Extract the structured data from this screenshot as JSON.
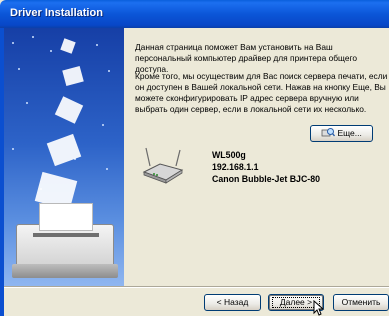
{
  "window": {
    "title": "Driver Installation"
  },
  "intro": {
    "paragraph1": "Данная страница поможет Вам установить на Ваш персональный компьютер драйвер для принтера общего доступа.",
    "paragraph2": "Кроме того, мы осуществим для Вас поиск сервера печати, если он доступен в Вашей локальной сети. Нажав на кнопку Еще, Вы можете сконфигурировать IP адрес сервера вручную или выбрать один сервер, если в локальной сети их несколько."
  },
  "more_button": {
    "label": "Еще..."
  },
  "device": {
    "name": "WL500g",
    "ip": "192.168.1.1",
    "printer": "Canon Bubble-Jet BJC-80"
  },
  "footer": {
    "back_label": "< Назад",
    "next_label": "Далее >",
    "cancel_label": "Отменить"
  },
  "colors": {
    "titlebar": "#0b56d8",
    "dialog_bg": "#ece9d8",
    "button_border": "#003c74"
  }
}
